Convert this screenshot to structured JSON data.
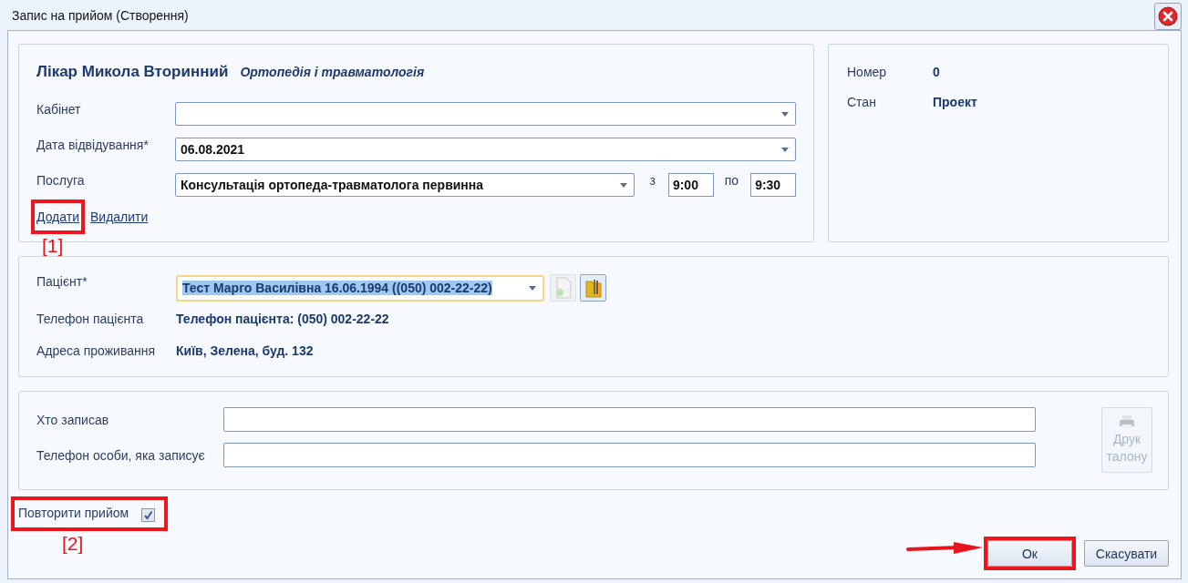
{
  "window": {
    "title": "Запис на прийом (Створення)"
  },
  "doctor": {
    "name": "Лікар Микола Вторинний",
    "specialty": "Ортопедія і травматологія"
  },
  "appointment_fields": [
    {
      "label": "Кабінет"
    },
    {
      "label": "Дата відвідування*",
      "value": "06.08.2021"
    }
  ],
  "service": {
    "label": "Послуга",
    "value": "Консультація ортопеда-травматолога первинна",
    "from_label": "з",
    "from": "9:00",
    "to_label": "по",
    "to": "9:30"
  },
  "links": [
    {
      "label": "Додати",
      "highlighted": true,
      "callout": "[1]"
    },
    {
      "label": "Видалити",
      "highlighted": false
    }
  ],
  "status": [
    {
      "label": "Номер",
      "value": "0"
    },
    {
      "label": "Стан",
      "value": "Проект"
    }
  ],
  "patient": {
    "label": "Пацієнт*",
    "value": "Тест Марго Василівна 16.06.1994 ((050) 002-22-22)",
    "focused": true
  },
  "patient_info": [
    {
      "label": "Телефон пацієнта",
      "value": "Телефон пацієнта: (050) 002-22-22"
    },
    {
      "label": "Адреса проживання",
      "value": "Київ, Зелена, буд. 132"
    }
  ],
  "recorder_fields": [
    {
      "label": "Хто записав"
    },
    {
      "label": "Телефон особи, яка записує"
    }
  ],
  "print_button": {
    "label": "Друк талону",
    "disabled": true
  },
  "repeat": {
    "label": "Повторити прийом",
    "checked": true,
    "highlighted": true,
    "callout": "[2]"
  },
  "buttons": [
    {
      "label": "Ок",
      "highlighted": true,
      "arrow": true
    },
    {
      "label": "Скасувати",
      "highlighted": false,
      "arrow": false
    }
  ]
}
